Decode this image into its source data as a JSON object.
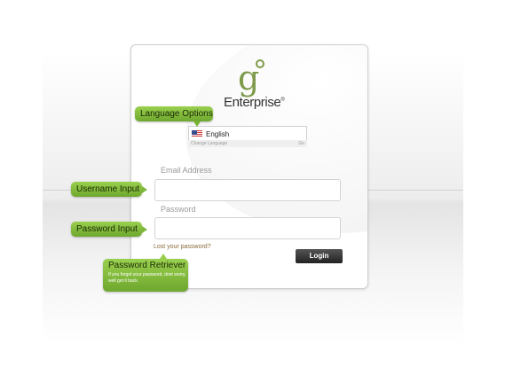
{
  "logo": {
    "mark": "g",
    "name": "Enterprise",
    "registered": "®"
  },
  "language": {
    "selected": "English",
    "change_label": "Change Language",
    "change_action": "Go"
  },
  "form": {
    "email_label": "Email Address",
    "password_label": "Password",
    "lost_password": "Lost your password?",
    "login_label": "Login"
  },
  "callouts": {
    "language": "Language Options",
    "username": "Username Input",
    "password": "Password Input",
    "retriever_title": "Password Retriever",
    "retriever_desc": "If you forget your password, dont worry, well get it back."
  },
  "colors": {
    "callout_green": "#7eb83a",
    "logo_green": "#7e9a4b",
    "button_dark": "#333333"
  }
}
